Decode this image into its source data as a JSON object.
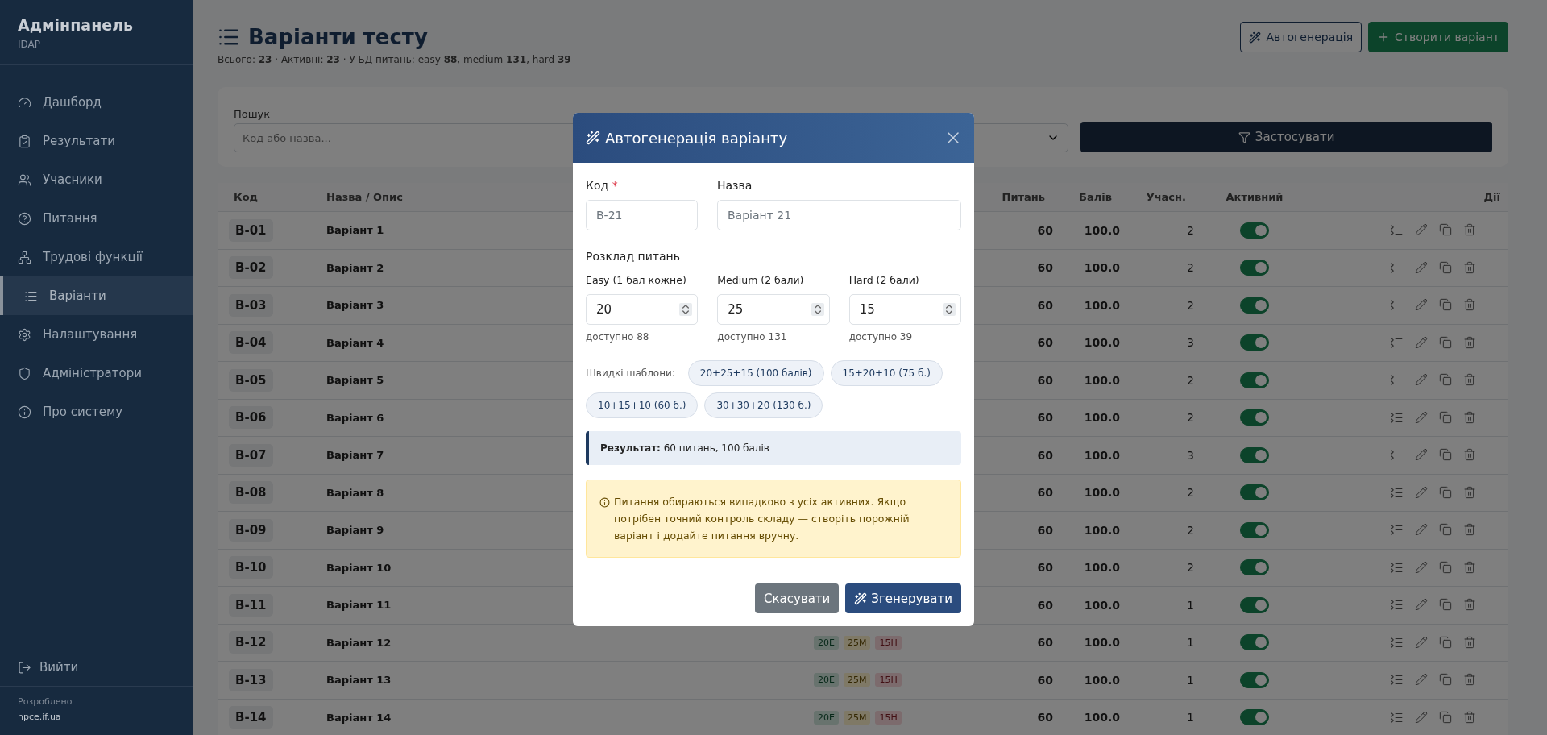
{
  "sidebar": {
    "title": "Адмінпанель",
    "subtitle": "IDAP",
    "items": [
      {
        "label": "Дашборд",
        "selected": false
      },
      {
        "label": "Результати",
        "selected": false
      },
      {
        "label": "Учасники",
        "selected": false
      },
      {
        "label": "Питання",
        "selected": false
      },
      {
        "label": "Трудові функції",
        "selected": false
      },
      {
        "label": "Варіанти",
        "selected": true
      },
      {
        "label": "Налаштування",
        "selected": false
      },
      {
        "label": "Адміністратори",
        "selected": false
      },
      {
        "label": "Про систему",
        "selected": false
      }
    ],
    "logout": "Вийти",
    "credit_label": "Розроблено",
    "credit_link": "npce.if.ua"
  },
  "page": {
    "title": "Варіанти тесту",
    "stats": "Всього: **23** · Активні: **23** · У БД питань: easy **88**, medium **131**, hard **39**",
    "buttons": [
      {
        "label": "Автогенерація",
        "kind": "outline"
      },
      {
        "label": "Створити варіант",
        "kind": "primary"
      }
    ]
  },
  "filters": {
    "search_label": "Пошук",
    "search_placeholder": "Код або назва...",
    "apply": "Застосувати"
  },
  "table": {
    "columns": [
      "Код",
      "Назва / Опис",
      "Питань",
      "Балів",
      "Учасн.",
      "Активний",
      "Дії"
    ],
    "rows": [
      {
        "code": "B-01",
        "name": "Варіант 1",
        "questions": "60",
        "points": "100.0",
        "participants": "2",
        "active": true
      },
      {
        "code": "B-02",
        "name": "Варіант 2",
        "questions": "60",
        "points": "100.0",
        "participants": "2",
        "active": true
      },
      {
        "code": "B-03",
        "name": "Варіант 3",
        "questions": "60",
        "points": "100.0",
        "participants": "2",
        "active": true
      },
      {
        "code": "B-04",
        "name": "Варіант 4",
        "questions": "60",
        "points": "100.0",
        "participants": "3",
        "active": true
      },
      {
        "code": "B-05",
        "name": "Варіант 5",
        "questions": "60",
        "points": "100.0",
        "participants": "2",
        "active": true
      },
      {
        "code": "B-06",
        "name": "Варіант 6",
        "questions": "60",
        "points": "100.0",
        "participants": "2",
        "active": true
      },
      {
        "code": "B-07",
        "name": "Варіант 7",
        "questions": "60",
        "points": "100.0",
        "participants": "3",
        "active": true
      },
      {
        "code": "B-08",
        "name": "Варіант 8",
        "questions": "60",
        "points": "100.0",
        "participants": "2",
        "active": true
      },
      {
        "code": "B-09",
        "name": "Варіант 9",
        "questions": "60",
        "points": "100.0",
        "participants": "2",
        "active": true
      },
      {
        "code": "B-10",
        "name": "Варіант 10",
        "questions": "60",
        "points": "100.0",
        "participants": "2",
        "active": true
      },
      {
        "code": "B-11",
        "name": "Варіант 11",
        "questions": "60",
        "points": "100.0",
        "participants": "1",
        "active": true
      },
      {
        "code": "B-12",
        "name": "Варіант 12",
        "mix": [
          {
            "label": "20E",
            "kind": "easy"
          },
          {
            "label": "25M",
            "kind": "medium"
          },
          {
            "label": "15H",
            "kind": "hard"
          }
        ],
        "questions": "60",
        "points": "100.0",
        "participants": "1",
        "active": true
      },
      {
        "code": "B-13",
        "name": "Варіант 13",
        "mix": [
          {
            "label": "20E",
            "kind": "easy"
          },
          {
            "label": "25M",
            "kind": "medium"
          },
          {
            "label": "15H",
            "kind": "hard"
          }
        ],
        "questions": "60",
        "points": "100.0",
        "participants": "1",
        "active": true
      },
      {
        "code": "B-14",
        "name": "Варіант 14",
        "mix": [
          {
            "label": "20E",
            "kind": "easy"
          },
          {
            "label": "25M",
            "kind": "medium"
          },
          {
            "label": "15H",
            "kind": "hard"
          }
        ],
        "questions": "60",
        "points": "100.0",
        "participants": "1",
        "active": true
      }
    ]
  },
  "modal": {
    "title": "Автогенерація варіанту",
    "code_label": "Код",
    "required_mark": "*",
    "code_placeholder": "B-21",
    "name_label": "Назва",
    "name_placeholder": "Варіант 21",
    "schedule_label": "Розклад питань",
    "levels": [
      {
        "label": "Easy (1 бал кожне)",
        "value": "20",
        "available": "доступно 88"
      },
      {
        "label": "Medium (2 бали)",
        "value": "25",
        "available": "доступно 131"
      },
      {
        "label": "Hard (2 бали)",
        "value": "15",
        "available": "доступно 39"
      }
    ],
    "templates_label": "Швидкі шаблони:",
    "templates": [
      "20+25+15 (100 балів)",
      "15+20+10 (75 б.)",
      "10+15+10 (60 б.)",
      "30+30+20 (130 б.)"
    ],
    "result": "**Результат:** 60 питань, 100 балів",
    "note": "Питання обираються випадково з усіх активних. Якщо потрібен точний контроль складу — створіть порожній варіант і додайте питання вручну.",
    "cancel": "Скасувати",
    "generate": "Згенерувати"
  }
}
